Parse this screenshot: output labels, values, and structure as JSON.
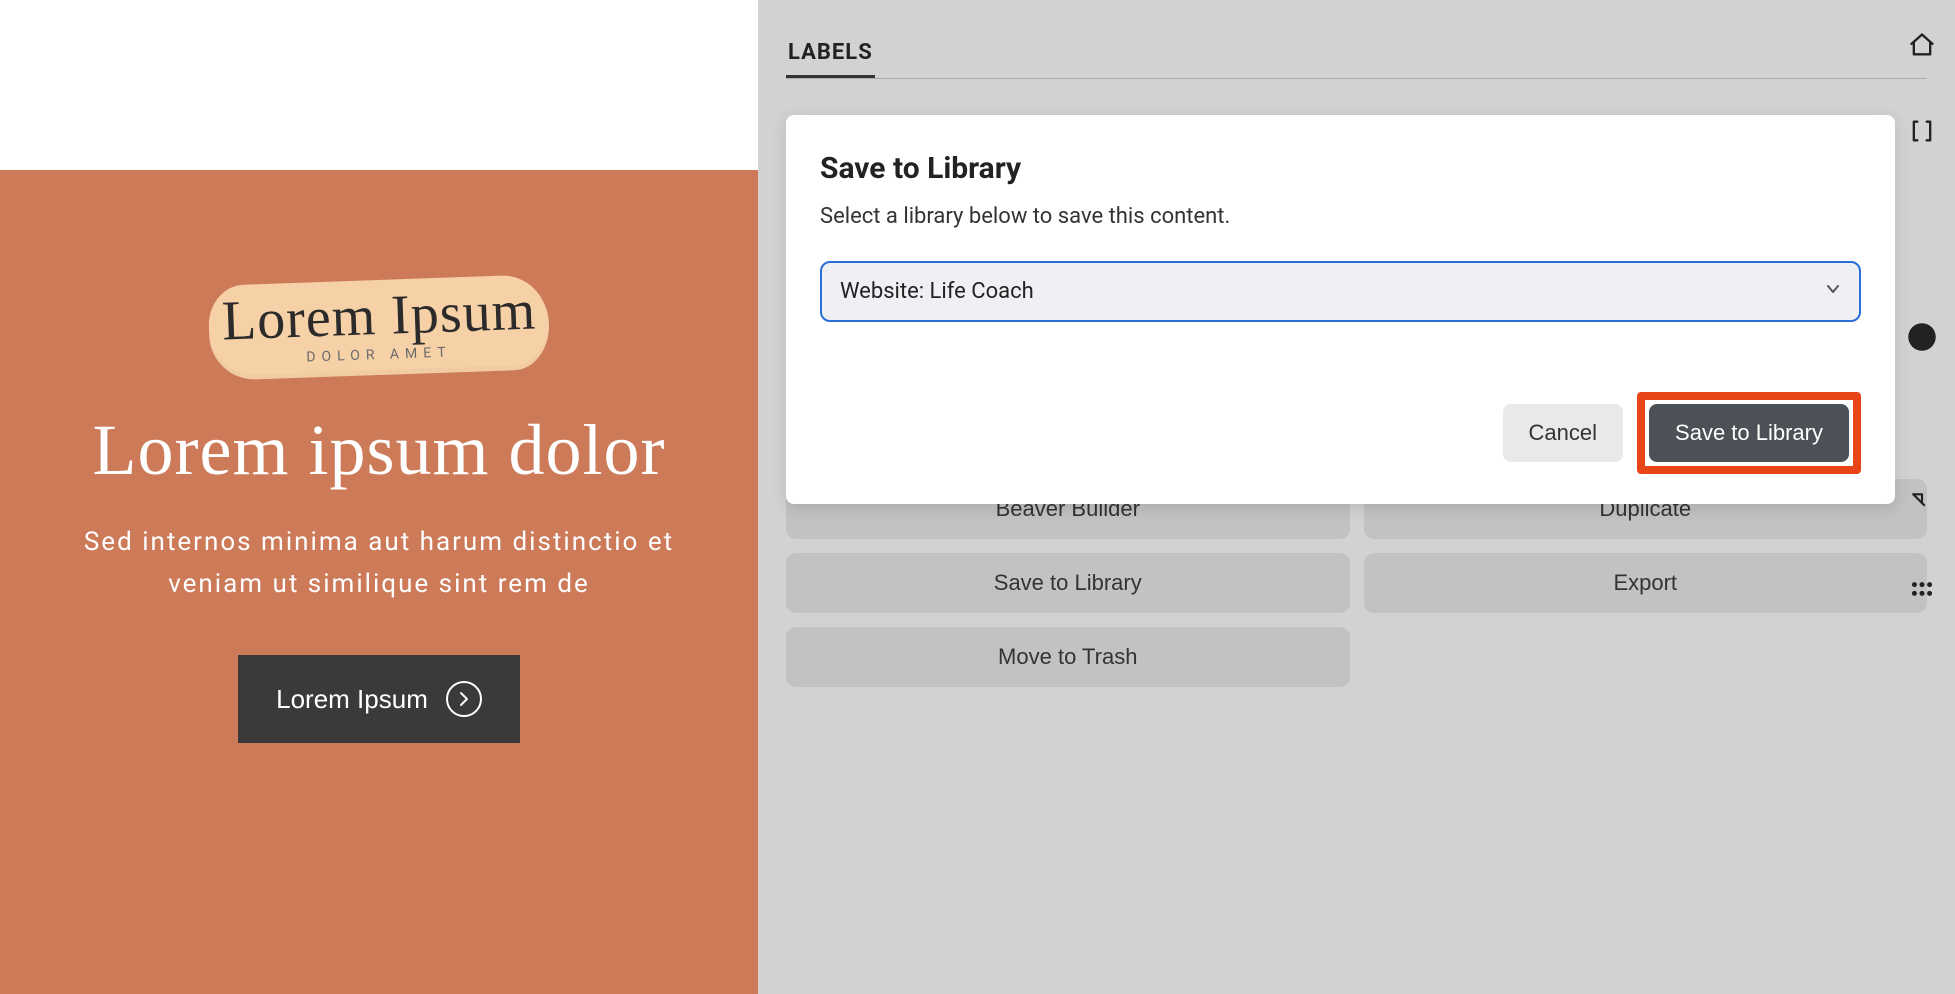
{
  "hero": {
    "logo_text": "Lorem Ipsum",
    "logo_sub": "DOLOR AMET",
    "title": "Lorem ipsum dolor",
    "description": "Sed internos minima aut harum distinctio et veniam ut similique sint rem de",
    "button_label": "Lorem Ipsum"
  },
  "panel": {
    "tab_label": "LABELS",
    "actions": {
      "beaver_builder": "Beaver Builder",
      "duplicate": "Duplicate",
      "save_to_library": "Save to Library",
      "export": "Export",
      "move_to_trash": "Move to Trash"
    }
  },
  "modal": {
    "title": "Save to Library",
    "description": "Select a library below to save this content.",
    "select_value": "Website: Life Coach",
    "cancel_label": "Cancel",
    "save_label": "Save to Library"
  }
}
